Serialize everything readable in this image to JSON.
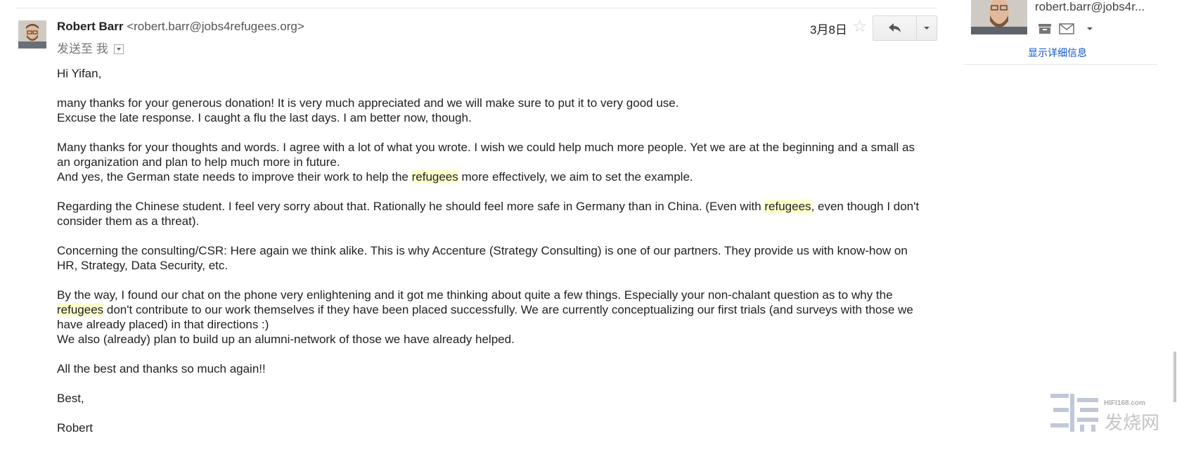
{
  "header": {
    "sender_name": "Robert Barr",
    "sender_email": "<robert.barr@jobs4refugees.org>",
    "to_label": "发送至",
    "to_value": "我",
    "date": "3月8日"
  },
  "icons": {
    "star": "star-icon",
    "reply": "reply-icon",
    "more": "chevron-down-icon",
    "archive": "archive-icon",
    "mail": "mail-icon"
  },
  "body": {
    "greeting": "Hi Yifan,",
    "p1_l1": "many thanks for your generous donation! It is very much appreciated and we will make sure to put it to very good use.",
    "p1_l2": "Excuse the late response. I caught a flu the last days. I am better now, though.",
    "p2_a": "Many thanks for your thoughts and words. I agree with a lot of what you wrote. I wish we could help much more people. Yet we are at the beginning and a small as an organization and plan to help much more in future.",
    "p2_b_pre": "And yes, the German state needs to improve their work to help the ",
    "p2_b_hl": "refugees",
    "p2_b_post": " more effectively, we aim to set the example.",
    "p3_pre": "Regarding the Chinese student. I feel very sorry about that. Rationally he should feel more safe in Germany than in China. (Even with ",
    "p3_hl": "refugees",
    "p3_post": ", even though I don't consider them as a threat).",
    "p4": "Concerning the consulting/CSR: Here again we think alike. This is why Accenture (Strategy Consulting) is one of our partners. They provide us with know-how on HR, Strategy, Data Security, etc.",
    "p5_pre": "By the way, I found our chat on the phone very enlightening and it got me thinking about quite a few things. Especially your non-chalant question as to why the ",
    "p5_hl": "refugees",
    "p5_post": " don't contribute to our work themselves if they have been placed successfully. We are currently conceptualizing our first trials (and surveys with those we have already placed) in that directions :)",
    "p5_l2": "We also (already) plan to build up an alumni-network of those we have already helped.",
    "p6": "All the best and thanks so much again!!",
    "p7": "Best,",
    "p8": "Robert"
  },
  "contact_panel": {
    "email": "robert.barr@jobs4r...",
    "show_details": "显示详细信息"
  },
  "watermark": {
    "site": "HIFI168.com",
    "name": "发烧网"
  },
  "colors": {
    "highlight": "#ffffcc",
    "link": "#1155cc"
  }
}
